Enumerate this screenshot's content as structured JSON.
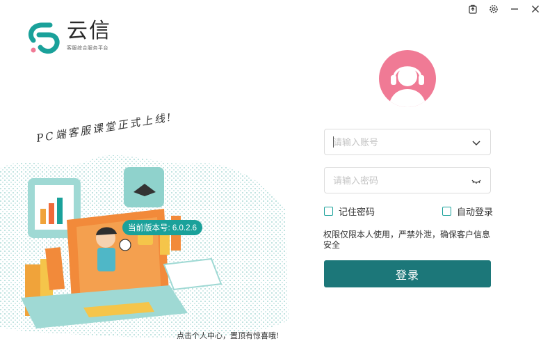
{
  "app": {
    "name": "云信",
    "subtitle": "客服综合服务平台"
  },
  "colors": {
    "brand": "#1aa19a",
    "button": "#1c7779",
    "avatar": "#f07a95"
  },
  "window_controls": {
    "icons": [
      "pin-icon",
      "gear-icon",
      "minimize-icon",
      "close-icon"
    ]
  },
  "promo": {
    "slogan": "PC端客服课堂正式上线!",
    "version_badge": "当前版本号: 6.0.2.6",
    "bottom_note": "点击个人中心，置顶有惊喜哦!"
  },
  "login": {
    "account_placeholder": "请输入账号",
    "password_placeholder": "请输入密码",
    "remember_label": "记住密码",
    "autologin_label": "自动登录",
    "notice": "权限仅限本人使用，严禁外泄，确保客户信息安全",
    "submit_label": "登录"
  }
}
